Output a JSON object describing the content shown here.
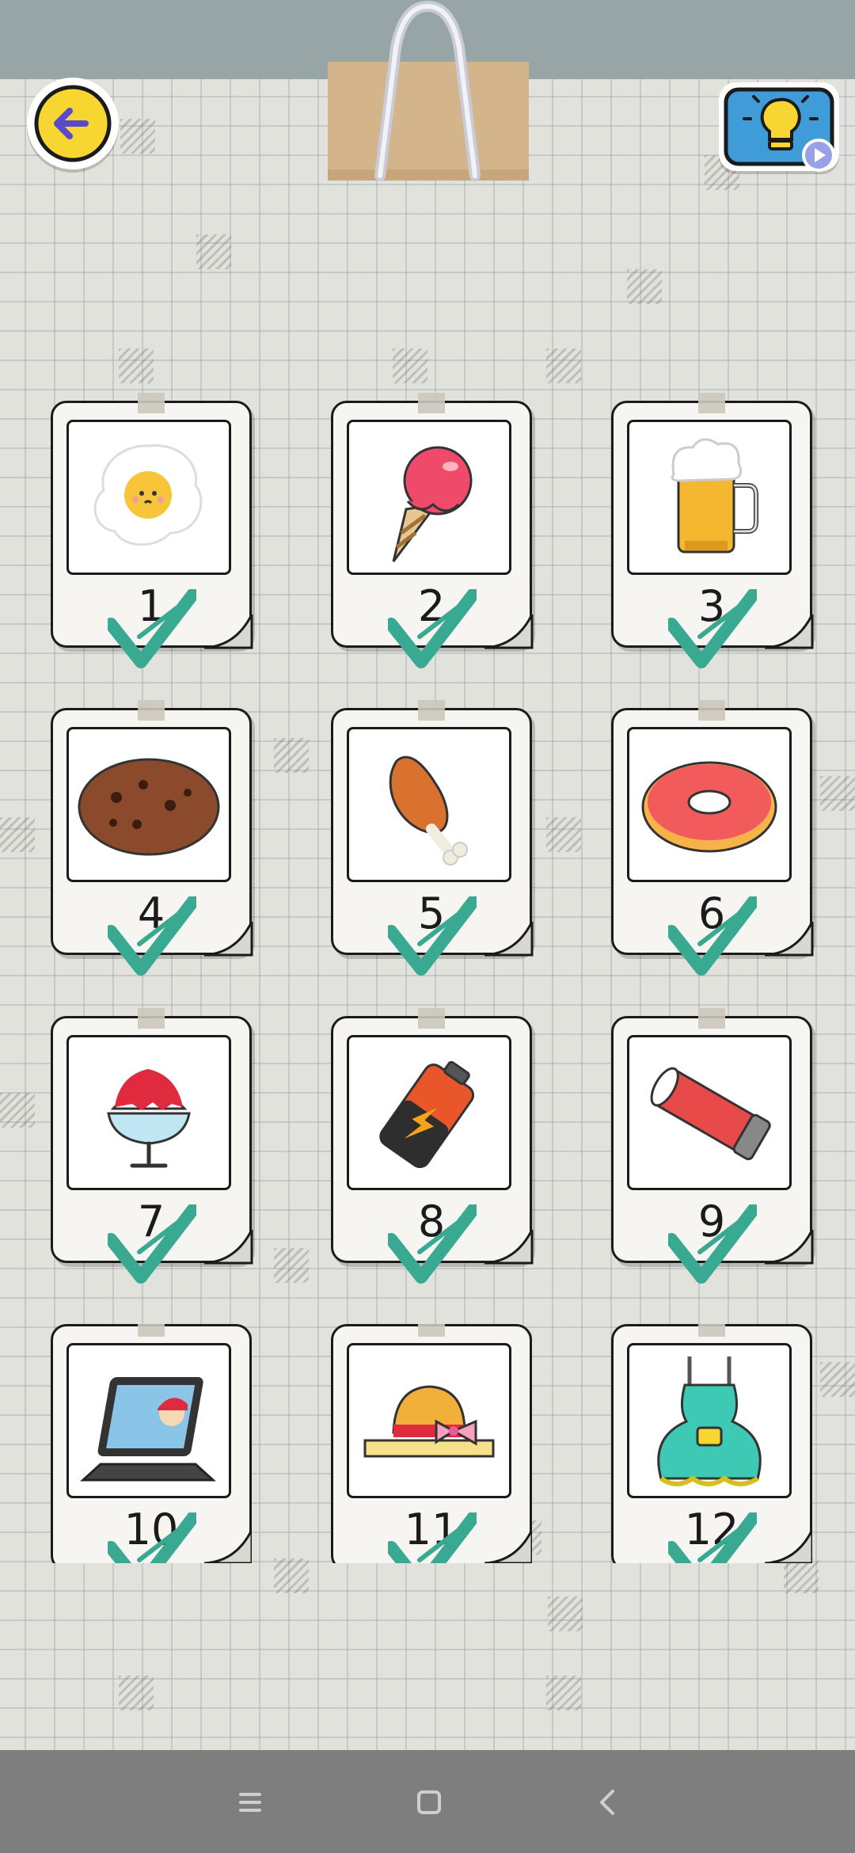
{
  "header": {
    "back_button": {
      "icon": "arrow-left-icon",
      "color": "#f7d631"
    },
    "hint_button": {
      "icon": "lightbulb-icon",
      "badge_icon": "play-icon",
      "color": "#3f9cd9"
    }
  },
  "levels": [
    {
      "number": "1",
      "item": "fried egg",
      "completed": true
    },
    {
      "number": "2",
      "item": "ice cream cone",
      "completed": true
    },
    {
      "number": "3",
      "item": "beer mug",
      "completed": true
    },
    {
      "number": "4",
      "item": "cookie",
      "completed": true
    },
    {
      "number": "5",
      "item": "chicken drumstick",
      "completed": true
    },
    {
      "number": "6",
      "item": "donut",
      "completed": true
    },
    {
      "number": "7",
      "item": "shaved ice",
      "completed": true
    },
    {
      "number": "8",
      "item": "battery",
      "completed": true
    },
    {
      "number": "9",
      "item": "lip balm",
      "completed": true
    },
    {
      "number": "10",
      "item": "laptop",
      "completed": true
    },
    {
      "number": "11",
      "item": "straw hat",
      "completed": true
    },
    {
      "number": "12",
      "item": "apron",
      "completed": true
    }
  ],
  "colors": {
    "check": "#3aa992",
    "topbar": "#97a5a6",
    "navbar": "#7e7e7e"
  },
  "nav": {
    "icons": [
      "menu-icon",
      "home-icon",
      "back-icon"
    ]
  }
}
